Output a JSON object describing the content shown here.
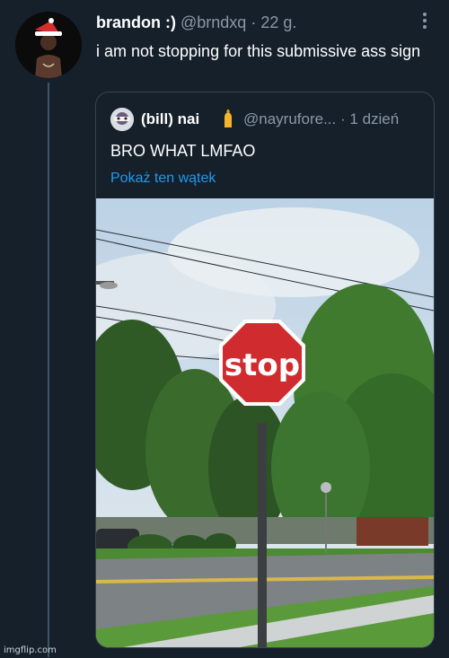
{
  "tweet": {
    "name": "brandon :)",
    "handle": "@brndxq",
    "separator": "·",
    "time": "22 g.",
    "text": "i am not stopping for this submissive ass sign"
  },
  "quote": {
    "name": "(bill) nai",
    "emoji_icon": "pinched-fingers-icon",
    "handle": "@nayrufore...",
    "separator": "·",
    "time": "1 dzień",
    "text": "BRO WHAT LMFAO",
    "show_thread": "Pokaż ten wątek"
  },
  "photo": {
    "sign_text": "stop"
  },
  "watermark": "imgflip.com",
  "colors": {
    "background": "#15202b",
    "link": "#1d9bf0",
    "muted": "#8b98a5",
    "border": "#38444d",
    "sign_red": "#d02b2e"
  }
}
